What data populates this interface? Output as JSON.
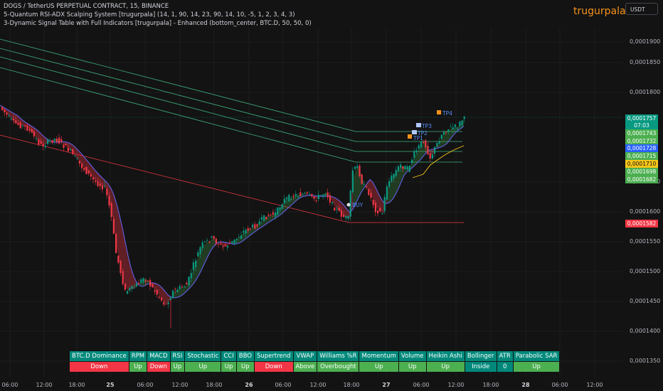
{
  "header": {
    "line1": "DOGS / TetherUS PERPETUAL CONTRACT, 15, BINANCE",
    "line2": "5-Quantum RSI-ADX Scalping System [trugurpala] (14, 1, 90, 14, 23, 90, 14, 10, -5, 1, 2, 3, 4, 3)",
    "line3": "3-Dynamic Signal Table with Full Indicators [trugurpala] - Enhanced (bottom_center, BTC.D, 50, 50, 0)"
  },
  "brand": "trugurpala",
  "currency": "USDT",
  "price_axis": [
    "0,0001900",
    "0,0001850",
    "0,0001800",
    "0,0001650",
    "0,0001600",
    "0,0001550",
    "0,0001500",
    "0,0001450",
    "0,0001400",
    "0,0001350"
  ],
  "badges": [
    {
      "value": "0,0001757",
      "sub": "07:03",
      "color": "#089981"
    },
    {
      "value": "0,0001743",
      "color": "#4caf50"
    },
    {
      "value": "0,0001732",
      "color": "#4caf50"
    },
    {
      "value": "0,0001728",
      "color": "#2962ff"
    },
    {
      "value": "0,0001715",
      "color": "#4caf50"
    },
    {
      "value": "0,0001710",
      "color": "#f5c518"
    },
    {
      "value": "0,0001698",
      "color": "#4caf50"
    },
    {
      "value": "0,0001682",
      "color": "#4caf50"
    },
    {
      "value": "0,0001582",
      "color": "#f23645"
    }
  ],
  "time_axis": [
    "06:00",
    "12:00",
    "18:00",
    "25",
    "06:00",
    "12:00",
    "18:00",
    "26",
    "06:00",
    "12:00",
    "18:00",
    "27",
    "06:00",
    "12:00",
    "18:00",
    "28",
    "06:00",
    "12:00"
  ],
  "labels": {
    "tp4": "TP4",
    "tp3": "TP3",
    "tp2": "TP2",
    "tp1": "TP1",
    "buy": "BUY"
  },
  "signal_table": {
    "headers": [
      "BTC.D Dominance",
      "RPM",
      "MACD",
      "RSI",
      "Stochastic",
      "CCI",
      "BBO",
      "Supertrend",
      "VWAP",
      "Williams %R",
      "Momentum",
      "Volume",
      "Heikin Ashi",
      "Bollinger",
      "ATR",
      "Parabolic SAR"
    ],
    "values": [
      "Down",
      "Up",
      "Down",
      "Up",
      "Up",
      "Up",
      "Up",
      "Down",
      "Above",
      "Overbought",
      "Up",
      "Up",
      "Up",
      "Inside",
      "0",
      "Up"
    ],
    "value_colors": [
      "r",
      "g",
      "r",
      "g",
      "g",
      "g",
      "g",
      "r",
      "g",
      "g",
      "g",
      "g",
      "g",
      "t",
      "t",
      "g"
    ]
  },
  "colors": {
    "up": "#089981",
    "down": "#f23645",
    "accent": "#f7931a",
    "ma": "#5b5bd6"
  }
}
